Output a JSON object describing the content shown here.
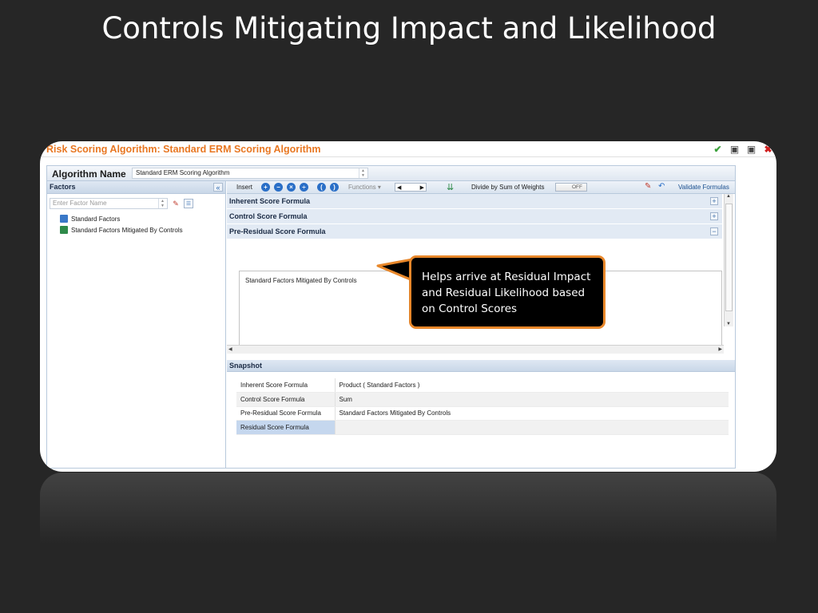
{
  "slide": {
    "title": "Controls Mitigating Impact and Likelihood"
  },
  "app": {
    "title": "Risk Scoring Algorithm: Standard ERM Scoring Algorithm",
    "algorithm_name_label": "Algorithm Name",
    "algorithm_name_value": "Standard ERM Scoring Algorithm"
  },
  "factors": {
    "header": "Factors",
    "search_placeholder": "Enter Factor Name",
    "items": [
      {
        "label": "Standard Factors",
        "icon": "factor-set-icon"
      },
      {
        "label": "Standard Factors Mitigated By Controls",
        "icon": "mitigated-factor-icon"
      }
    ]
  },
  "toolbar": {
    "insert_label": "Insert",
    "functions_label": "Functions",
    "divide_label": "Divide by Sum of Weights",
    "toggle_value": "OFF",
    "validate_label": "Validate Formulas"
  },
  "sections": [
    {
      "label": "Inherent Score Formula",
      "state": "+"
    },
    {
      "label": "Control Score Formula",
      "state": "+"
    },
    {
      "label": "Pre-Residual Score Formula",
      "state": "−"
    }
  ],
  "formula_editor": {
    "text": "Standard Factors Mitigated By Controls"
  },
  "snapshot": {
    "header": "Snapshot",
    "rows": [
      {
        "key": "Inherent Score Formula",
        "value": "Product ( Standard Factors )"
      },
      {
        "key": "Control Score Formula",
        "value": "Sum"
      },
      {
        "key": "Pre-Residual Score Formula",
        "value": "Standard Factors Mitigated By Controls"
      },
      {
        "key": "Residual Score Formula",
        "value": ""
      }
    ]
  },
  "callout": {
    "text": "Helps arrive at Residual Impact and Residual Likelihood based on Control Scores"
  },
  "colors": {
    "accent": "#e87722",
    "callout_border": "#e8872a",
    "background": "#262626"
  }
}
